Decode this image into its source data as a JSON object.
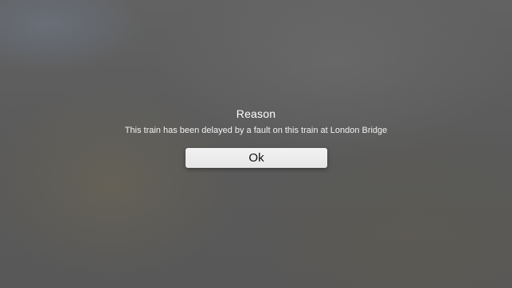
{
  "dialog": {
    "title": "Reason",
    "message": "This train has been delayed by a fault on this train at London Bridge",
    "ok_label": "Ok"
  },
  "colors": {
    "background": "#5e5e5e",
    "button_background": "#eeeeee",
    "title_text": "#ffffff"
  }
}
